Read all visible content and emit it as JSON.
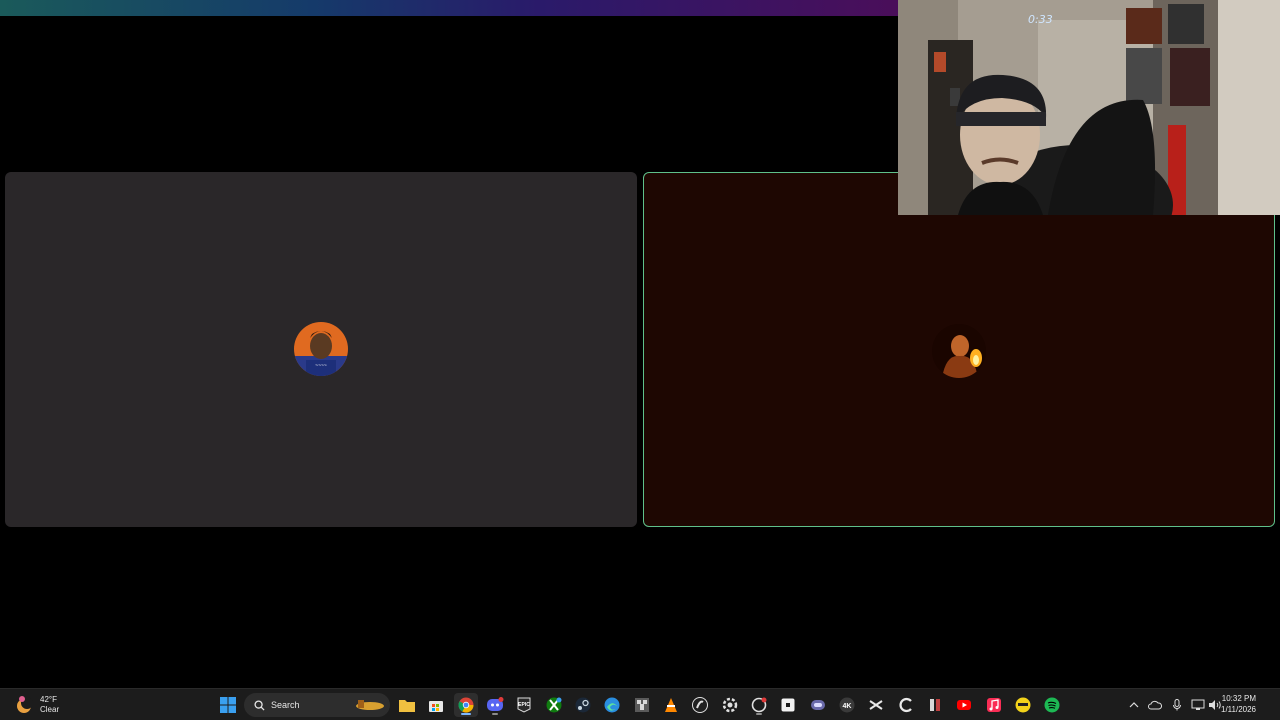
{
  "camera": {
    "timer": "0:33"
  },
  "taskbar": {
    "weather": {
      "temp": "42°F",
      "condition": "Clear"
    },
    "search": {
      "placeholder": "Search"
    },
    "clock": {
      "time": "10:32 PM",
      "date": "1/11/2026"
    },
    "apps": [
      "start-icon",
      "search-icon",
      "widget-icon",
      "file-explorer-icon",
      "store-icon",
      "chrome-icon",
      "discord-icon",
      "epic-games-icon",
      "xbox-icon",
      "steam-icon",
      "edge-icon",
      "minecraft-icon",
      "vlc-icon",
      "obs-icon",
      "settings-icon",
      "ubisoft-icon",
      "roblox-icon",
      "app-icon",
      "4k-icon",
      "capcut-icon",
      "ccleaner-icon",
      "tools-icon",
      "youtube-icon",
      "itunes-icon",
      "emoji-icon",
      "spotify-icon"
    ]
  },
  "colors": {
    "speaking_border": "#5fc08a",
    "tile_left_bg": "#2a2729",
    "tile_right_bg": "#1e0702"
  }
}
